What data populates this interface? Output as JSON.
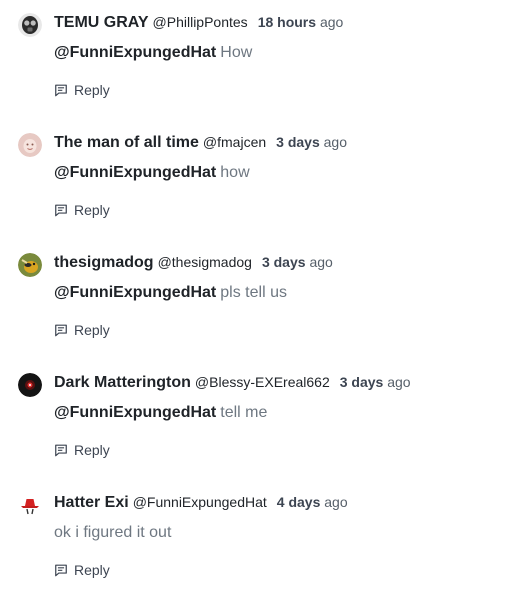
{
  "comments": [
    {
      "display_name": "TEMU GRAY",
      "username": "@PhillipPontes",
      "time_value": "18 hours",
      "time_suffix": "ago",
      "mention": "@FunniExpungedHat",
      "text": "How",
      "reply_label": "Reply",
      "avatar_icon": "gasmask-avatar"
    },
    {
      "display_name": "The man of all time",
      "username": "@fmajcen",
      "time_value": "3 days",
      "time_suffix": "ago",
      "mention": "@FunniExpungedHat",
      "text": "how",
      "reply_label": "Reply",
      "avatar_icon": "face-avatar"
    },
    {
      "display_name": "thesigmadog",
      "username": "@thesigmadog",
      "time_value": "3 days",
      "time_suffix": "ago",
      "mention": "@FunniExpungedHat",
      "text": "pls tell us",
      "reply_label": "Reply",
      "avatar_icon": "dog-avatar"
    },
    {
      "display_name": "Dark Matterington",
      "username": "@Blessy-EXEreal662",
      "time_value": "3 days",
      "time_suffix": "ago",
      "mention": "@FunniExpungedHat",
      "text": "tell me",
      "reply_label": "Reply",
      "avatar_icon": "eye-avatar"
    },
    {
      "display_name": "Hatter Exi",
      "username": "@FunniExpungedHat",
      "time_value": "4 days",
      "time_suffix": "ago",
      "mention": "",
      "text": "ok i figured it out",
      "reply_label": "Reply",
      "avatar_icon": "red-hat-avatar"
    }
  ]
}
